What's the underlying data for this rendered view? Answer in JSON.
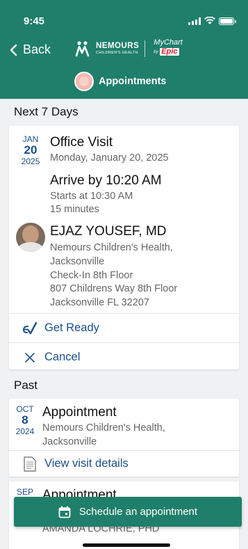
{
  "status_bar": {
    "time": "9:45"
  },
  "header": {
    "back_label": "Back",
    "brand_nemours": "NEMOURS",
    "brand_nemours_sub": "CHILDREN'S HEALTH",
    "brand_mychart": "MyChart",
    "brand_by": "by",
    "brand_epic": "Epic",
    "page_title": "Appointments"
  },
  "sections": {
    "upcoming": "Next 7 Days",
    "past": "Past"
  },
  "upcoming_appointment": {
    "month": "JAN",
    "day": "20",
    "year": "2025",
    "title": "Office Visit",
    "date_text": "Monday, January 20, 2025",
    "arrive_by": "Arrive by 10:20 AM",
    "starts_at": "Starts at 10:30 AM",
    "duration": "15 minutes",
    "provider": {
      "name": "EJAZ YOUSEF, MD",
      "location_line1": "Nemours Children's Health,",
      "location_line2": "Jacksonville",
      "department": "Check-In 8th Floor",
      "address_line1": "807 Childrens Way 8th Floor",
      "address_line2": "Jacksonville FL 32207"
    },
    "actions": {
      "get_ready": "Get Ready",
      "cancel": "Cancel"
    }
  },
  "past_appointments": [
    {
      "month": "OCT",
      "day": "8",
      "year": "2024",
      "title": "Appointment",
      "location_line1": "Nemours Children's Health,",
      "location_line2": "Jacksonville",
      "action": "View visit details"
    },
    {
      "month": "SEP",
      "title": "Appointment",
      "provider": "AMANDA LOCHRIE, PHD"
    }
  ],
  "footer": {
    "schedule_button": "Schedule an appointment"
  },
  "colors": {
    "brand_green": "#1f7f6b",
    "link_blue": "#1d4f8a",
    "epic_red": "#d81e2a"
  }
}
